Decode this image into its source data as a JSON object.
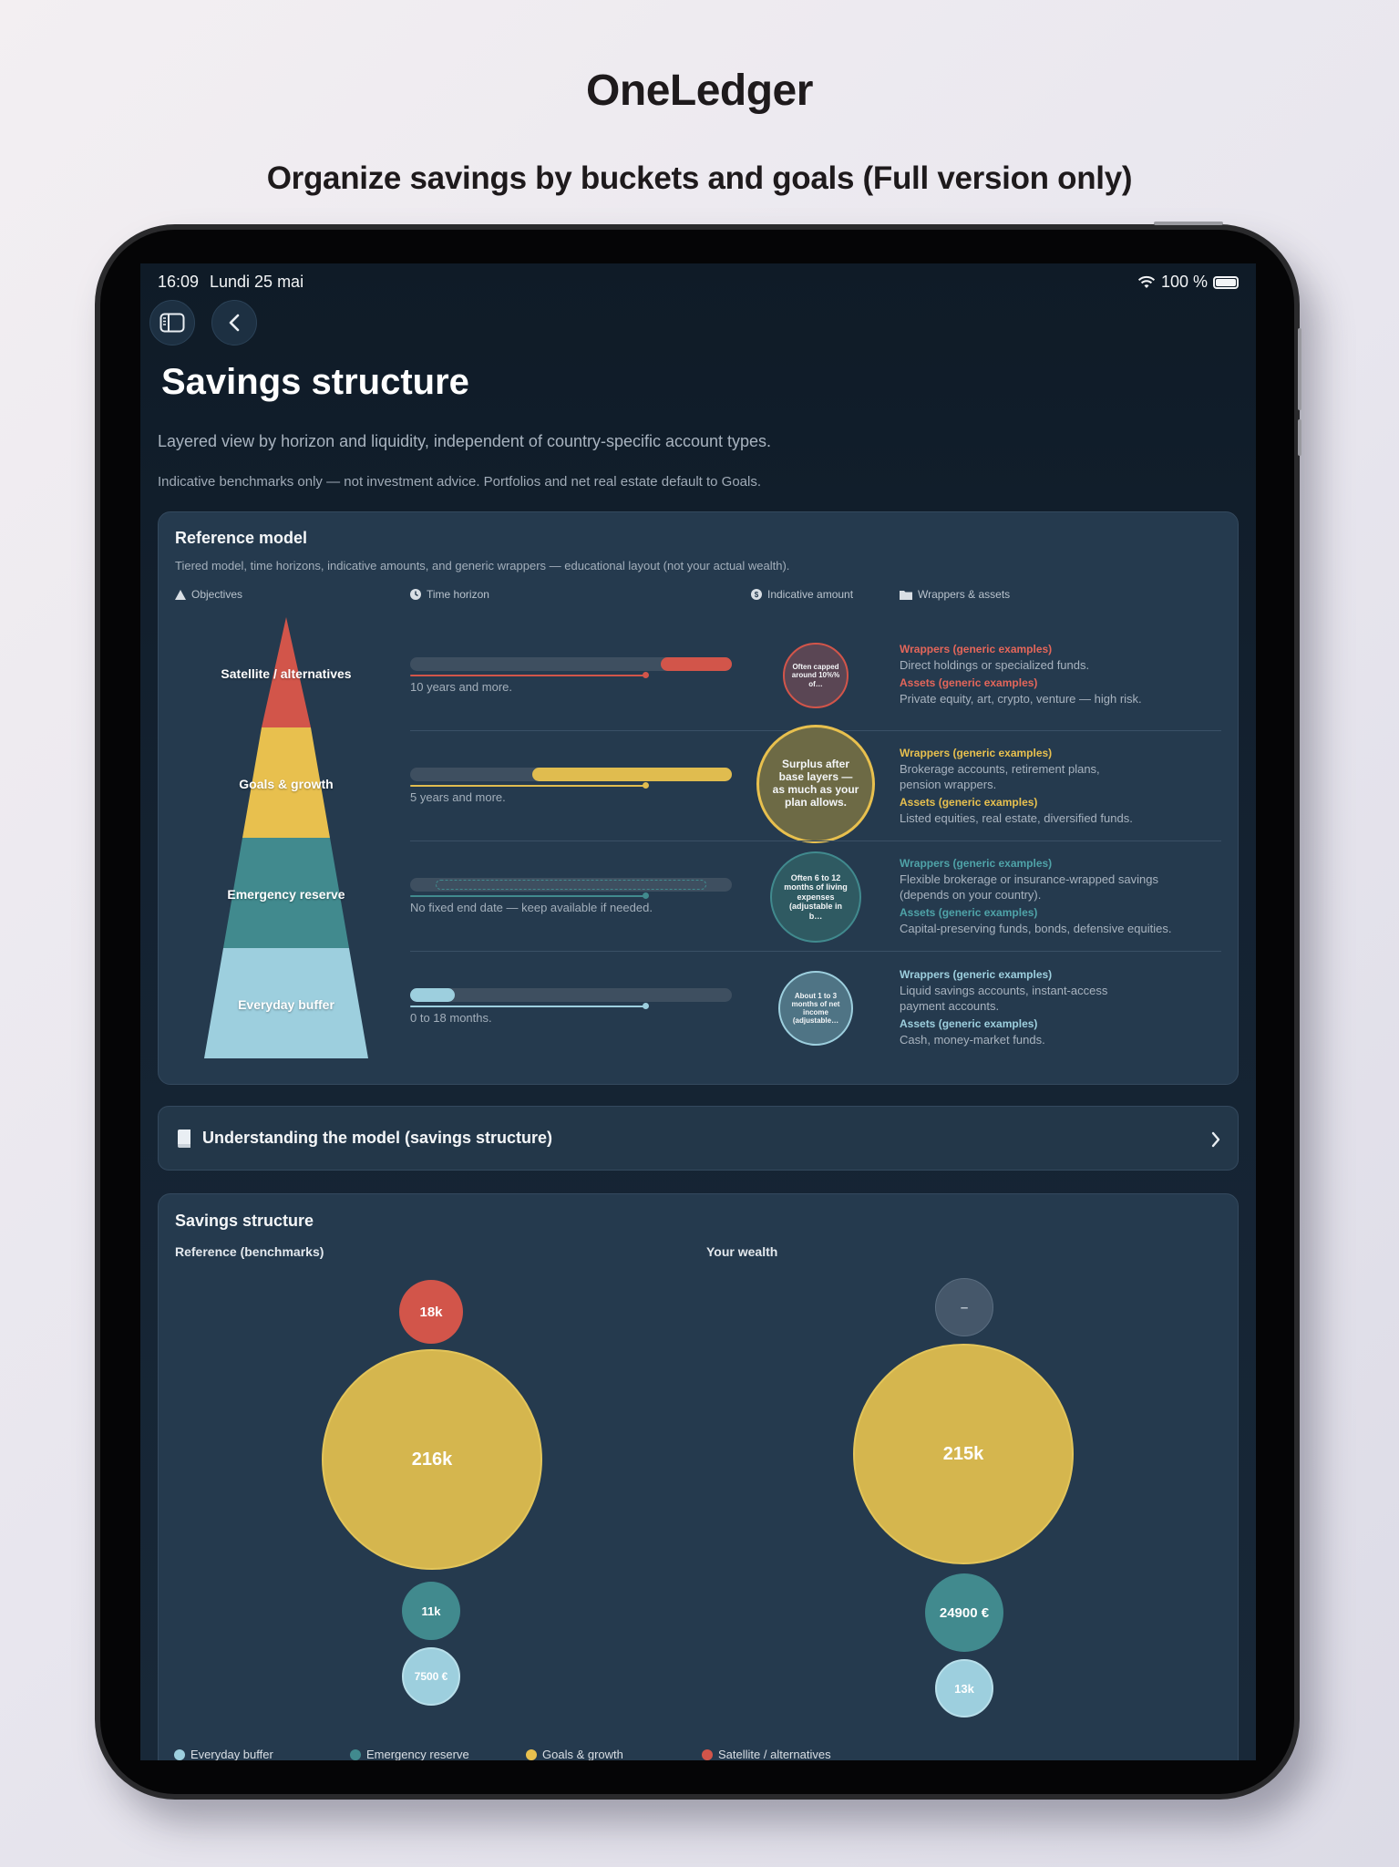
{
  "app_title": "OneLedger",
  "headline": "Organize savings by buckets and goals (Full version only)",
  "status": {
    "time": "16:09",
    "date": "Lundi 25 mai",
    "battery": "100 %"
  },
  "page": {
    "title": "Savings structure",
    "description": "Layered view by horizon and liquidity, independent of country-specific account types.",
    "note": "Indicative benchmarks only — not investment advice. Portfolios and net real estate default to Goals."
  },
  "reference_model": {
    "title": "Reference model",
    "subtitle": "Tiered model, time horizons, indicative amounts, and generic wrappers — educational layout (not your actual wealth).",
    "columns": {
      "objectives": "Objectives",
      "time_horizon": "Time horizon",
      "amount": "Indicative amount",
      "wrappers": "Wrappers & assets"
    },
    "tiers": [
      {
        "label": "Satellite / alternatives",
        "color": "#d2554a",
        "horizon": "10 years and more.",
        "bar_fill_fraction": 0.22,
        "amount": "Often capped around 10%% of…",
        "wrappers_heading": "Wrappers (generic examples)",
        "wrappers_text": "Direct holdings or specialized funds.",
        "assets_heading": "Assets (generic examples)",
        "assets_text": "Private equity, art, crypto, venture — high risk."
      },
      {
        "label": "Goals & growth",
        "color": "#e8c04e",
        "horizon": "5 years and more.",
        "bar_fill_fraction": 0.62,
        "amount": "Surplus after base layers — as much as your plan allows.",
        "wrappers_heading": "Wrappers (generic examples)",
        "wrappers_text": "Brokerage accounts, retirement plans, pension wrappers.",
        "assets_heading": "Assets (generic examples)",
        "assets_text": "Listed equities, real estate, diversified funds."
      },
      {
        "label": "Emergency reserve",
        "color": "#418a8e",
        "horizon": "No fixed end date — keep available if needed.",
        "bar_fill_fraction": 0,
        "amount": "Often 6 to 12 months of living expenses (adjustable in b…",
        "wrappers_heading": "Wrappers (generic examples)",
        "wrappers_text": "Flexible brokerage or insurance-wrapped savings (depends on your country).",
        "assets_heading": "Assets (generic examples)",
        "assets_text": "Capital-preserving funds, bonds, defensive equities."
      },
      {
        "label": "Everyday buffer",
        "color": "#9dcfde",
        "horizon": "0 to 18 months.",
        "bar_fill_fraction": 0.14,
        "amount": "About 1 to 3 months of net income (adjustable…",
        "wrappers_heading": "Wrappers (generic examples)",
        "wrappers_text": "Liquid savings accounts, instant-access payment accounts.",
        "assets_heading": "Assets (generic examples)",
        "assets_text": "Cash, money-market funds."
      }
    ]
  },
  "understanding": {
    "label": "Understanding the model (savings structure)"
  },
  "savings_structure": {
    "title": "Savings structure",
    "reference_label": "Reference (benchmarks)",
    "wealth_label": "Your wealth",
    "reference": {
      "satellite": "18k",
      "goals": "216k",
      "emergency": "11k",
      "buffer": "7500 €"
    },
    "wealth": {
      "satellite": "–",
      "goals": "215k",
      "emergency": "24900 €",
      "buffer": "13k"
    },
    "legend": [
      "Everyday buffer",
      "Emergency reserve",
      "Goals & growth",
      "Satellite / alternatives"
    ]
  }
}
